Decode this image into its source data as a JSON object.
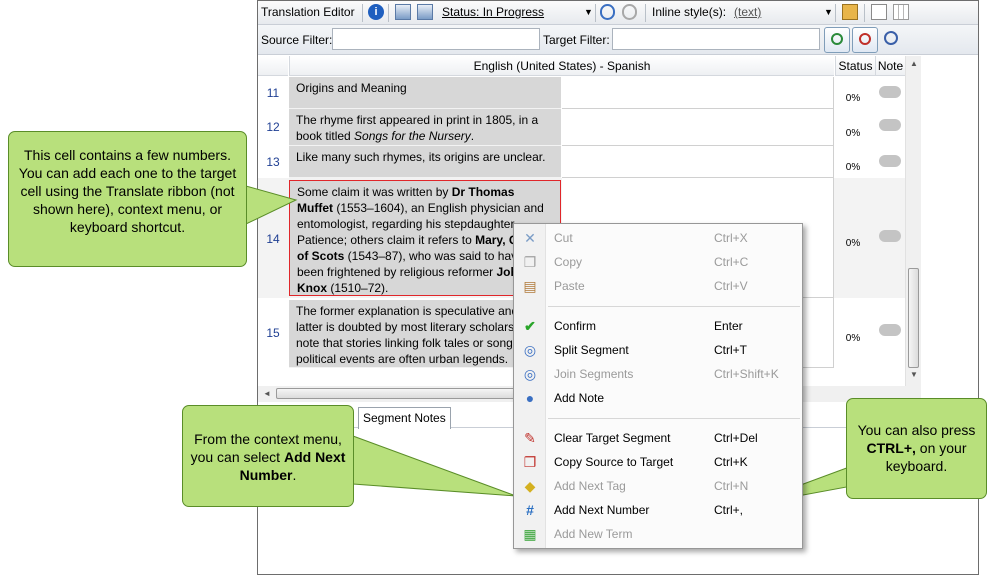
{
  "toolbar": {
    "title": "Translation Editor",
    "status": "Status: In Progress",
    "inline_label": "Inline style(s):",
    "inline_value": "(text)"
  },
  "filters": {
    "source_label": "Source Filter:",
    "target_label": "Target Filter:"
  },
  "grid": {
    "col_header": "English (United States) - Spanish",
    "status_header": "Status",
    "note_header": "Note",
    "rows": [
      {
        "num": "11",
        "status": "0%"
      },
      {
        "num": "12",
        "status": "0%"
      },
      {
        "num": "13",
        "status": "0%"
      },
      {
        "num": "14",
        "status": "0%"
      },
      {
        "num": "15",
        "status": "0%"
      }
    ],
    "r11": "Origins and Meaning",
    "r12a": "The rhyme first appeared in print in 1805, in a book titled ",
    "r12b": "Songs for the Nursery",
    "r13": "Like many such rhymes, its origins are unclear.",
    "r14a": "Some claim it was written by ",
    "r14b": "Dr Thomas Muffet",
    "r14c": " (1553–1604), an English physician and entomologist, regarding his stepdaughter, Patience; others claim it refers to ",
    "r14d": "Mary, Queen of Scots",
    "r14e": " (1543–87), who was said to have been frightened by religious reformer ",
    "r14f": "John Knox",
    "r14g": " (1510–72).",
    "r15": "The former explanation is speculative and the latter is doubted by most literary scholars, who note that stories linking folk tales or songs to political events are often urban legends."
  },
  "tab": "Segment Notes",
  "menu": [
    {
      "label": "Cut",
      "shortcut": "Ctrl+X",
      "icon": "cut-icon"
    },
    {
      "label": "Copy",
      "shortcut": "Ctrl+C",
      "icon": "copy-icon"
    },
    {
      "label": "Paste",
      "shortcut": "Ctrl+V",
      "icon": "paste-icon"
    },
    {
      "label": "Confirm",
      "shortcut": "Enter",
      "icon": "check-icon"
    },
    {
      "label": "Split Segment",
      "shortcut": "Ctrl+T",
      "icon": "split-icon"
    },
    {
      "label": "Join Segments",
      "shortcut": "Ctrl+Shift+K",
      "icon": "join-icon"
    },
    {
      "label": "Add Note",
      "shortcut": "",
      "icon": "note-icon"
    },
    {
      "label": "Clear Target Segment",
      "shortcut": "Ctrl+Del",
      "icon": "clear-icon"
    },
    {
      "label": "Copy Source to Target",
      "shortcut": "Ctrl+K",
      "icon": "copy-source-icon"
    },
    {
      "label": "Add Next Tag",
      "shortcut": "Ctrl+N",
      "icon": "tag-icon"
    },
    {
      "label": "Add Next Number",
      "shortcut": "Ctrl+,",
      "icon": "number-icon"
    },
    {
      "label": "Add New Term",
      "shortcut": "",
      "icon": "term-icon"
    }
  ],
  "callouts": {
    "left": "This cell contains a few numbers. You can add each one to the target cell using the Translate ribbon (not shown here), context menu, or keyboard shortcut.",
    "mid_a": "From the context menu, you can select ",
    "mid_b": "Add Next Number",
    "mid_c": ".",
    "right_a": "You can also press ",
    "right_b": "CTRL+,",
    "right_c": " on your keyboard."
  }
}
